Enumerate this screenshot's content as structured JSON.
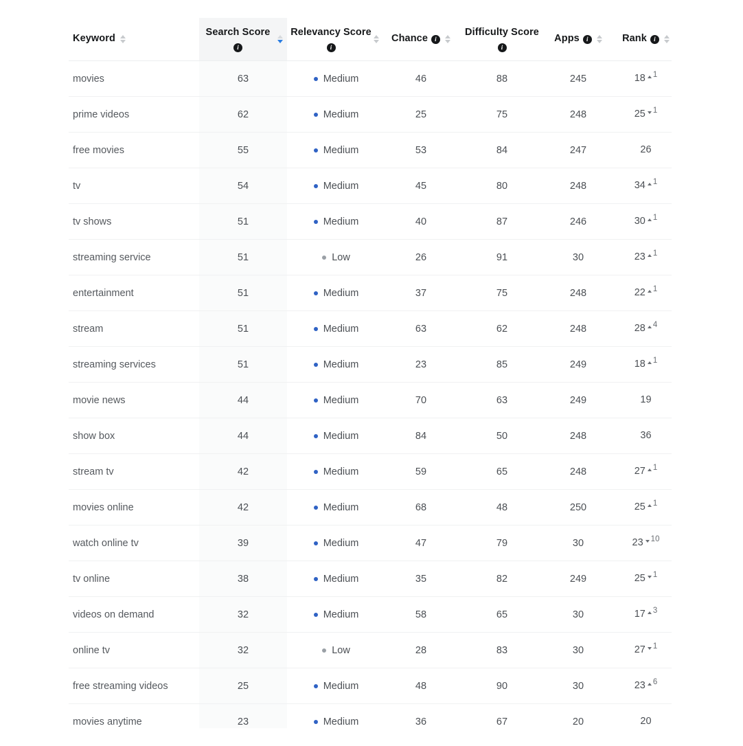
{
  "table": {
    "sorted_column": "Search Score",
    "sort_direction": "desc",
    "accent_color": "#2a7de1",
    "medium_dot_color": "#2f62c4",
    "low_dot_color": "#9aa0a6",
    "columns": [
      {
        "key": "keyword",
        "label": "Keyword",
        "info": false,
        "sortable": true,
        "align": "left"
      },
      {
        "key": "search",
        "label": "Search Score",
        "info": true,
        "sortable": true,
        "align": "center"
      },
      {
        "key": "relevancy",
        "label": "Relevancy Score",
        "info": true,
        "sortable": true,
        "align": "center"
      },
      {
        "key": "chance",
        "label": "Chance",
        "info": true,
        "sortable": true,
        "align": "center"
      },
      {
        "key": "difficulty",
        "label": "Difficulty Score",
        "info": true,
        "sortable": false,
        "align": "center"
      },
      {
        "key": "apps",
        "label": "Apps",
        "info": true,
        "sortable": true,
        "align": "center"
      },
      {
        "key": "rank",
        "label": "Rank",
        "info": true,
        "sortable": true,
        "align": "center"
      }
    ],
    "info_icon": "info-icon",
    "sort_icon": "sort-chevrons-icon",
    "rows": [
      {
        "keyword": "movies",
        "search": "63",
        "relevancy": "Medium",
        "relevancy_level": "medium",
        "chance": "46",
        "difficulty": "88",
        "apps": "245",
        "rank": "18",
        "delta": "1",
        "delta_dir": "up"
      },
      {
        "keyword": "prime videos",
        "search": "62",
        "relevancy": "Medium",
        "relevancy_level": "medium",
        "chance": "25",
        "difficulty": "75",
        "apps": "248",
        "rank": "25",
        "delta": "1",
        "delta_dir": "down"
      },
      {
        "keyword": "free movies",
        "search": "55",
        "relevancy": "Medium",
        "relevancy_level": "medium",
        "chance": "53",
        "difficulty": "84",
        "apps": "247",
        "rank": "26",
        "delta": "",
        "delta_dir": "none"
      },
      {
        "keyword": "tv",
        "search": "54",
        "relevancy": "Medium",
        "relevancy_level": "medium",
        "chance": "45",
        "difficulty": "80",
        "apps": "248",
        "rank": "34",
        "delta": "1",
        "delta_dir": "up"
      },
      {
        "keyword": "tv shows",
        "search": "51",
        "relevancy": "Medium",
        "relevancy_level": "medium",
        "chance": "40",
        "difficulty": "87",
        "apps": "246",
        "rank": "30",
        "delta": "1",
        "delta_dir": "up"
      },
      {
        "keyword": "streaming service",
        "search": "51",
        "relevancy": "Low",
        "relevancy_level": "low",
        "chance": "26",
        "difficulty": "91",
        "apps": "30",
        "rank": "23",
        "delta": "1",
        "delta_dir": "up"
      },
      {
        "keyword": "entertainment",
        "search": "51",
        "relevancy": "Medium",
        "relevancy_level": "medium",
        "chance": "37",
        "difficulty": "75",
        "apps": "248",
        "rank": "22",
        "delta": "1",
        "delta_dir": "up"
      },
      {
        "keyword": "stream",
        "search": "51",
        "relevancy": "Medium",
        "relevancy_level": "medium",
        "chance": "63",
        "difficulty": "62",
        "apps": "248",
        "rank": "28",
        "delta": "4",
        "delta_dir": "up"
      },
      {
        "keyword": "streaming services",
        "search": "51",
        "relevancy": "Medium",
        "relevancy_level": "medium",
        "chance": "23",
        "difficulty": "85",
        "apps": "249",
        "rank": "18",
        "delta": "1",
        "delta_dir": "up"
      },
      {
        "keyword": "movie news",
        "search": "44",
        "relevancy": "Medium",
        "relevancy_level": "medium",
        "chance": "70",
        "difficulty": "63",
        "apps": "249",
        "rank": "19",
        "delta": "",
        "delta_dir": "none"
      },
      {
        "keyword": "show box",
        "search": "44",
        "relevancy": "Medium",
        "relevancy_level": "medium",
        "chance": "84",
        "difficulty": "50",
        "apps": "248",
        "rank": "36",
        "delta": "",
        "delta_dir": "none"
      },
      {
        "keyword": "stream tv",
        "search": "42",
        "relevancy": "Medium",
        "relevancy_level": "medium",
        "chance": "59",
        "difficulty": "65",
        "apps": "248",
        "rank": "27",
        "delta": "1",
        "delta_dir": "up"
      },
      {
        "keyword": "movies online",
        "search": "42",
        "relevancy": "Medium",
        "relevancy_level": "medium",
        "chance": "68",
        "difficulty": "48",
        "apps": "250",
        "rank": "25",
        "delta": "1",
        "delta_dir": "up"
      },
      {
        "keyword": "watch online tv",
        "search": "39",
        "relevancy": "Medium",
        "relevancy_level": "medium",
        "chance": "47",
        "difficulty": "79",
        "apps": "30",
        "rank": "23",
        "delta": "10",
        "delta_dir": "down"
      },
      {
        "keyword": "tv online",
        "search": "38",
        "relevancy": "Medium",
        "relevancy_level": "medium",
        "chance": "35",
        "difficulty": "82",
        "apps": "249",
        "rank": "25",
        "delta": "1",
        "delta_dir": "down"
      },
      {
        "keyword": "videos on demand",
        "search": "32",
        "relevancy": "Medium",
        "relevancy_level": "medium",
        "chance": "58",
        "difficulty": "65",
        "apps": "30",
        "rank": "17",
        "delta": "3",
        "delta_dir": "up"
      },
      {
        "keyword": "online tv",
        "search": "32",
        "relevancy": "Low",
        "relevancy_level": "low",
        "chance": "28",
        "difficulty": "83",
        "apps": "30",
        "rank": "27",
        "delta": "1",
        "delta_dir": "down"
      },
      {
        "keyword": "free streaming videos",
        "search": "25",
        "relevancy": "Medium",
        "relevancy_level": "medium",
        "chance": "48",
        "difficulty": "90",
        "apps": "30",
        "rank": "23",
        "delta": "6",
        "delta_dir": "up"
      },
      {
        "keyword": "movies anytime",
        "search": "23",
        "relevancy": "Medium",
        "relevancy_level": "medium",
        "chance": "36",
        "difficulty": "67",
        "apps": "20",
        "rank": "20",
        "delta": "",
        "delta_dir": "none"
      }
    ]
  }
}
